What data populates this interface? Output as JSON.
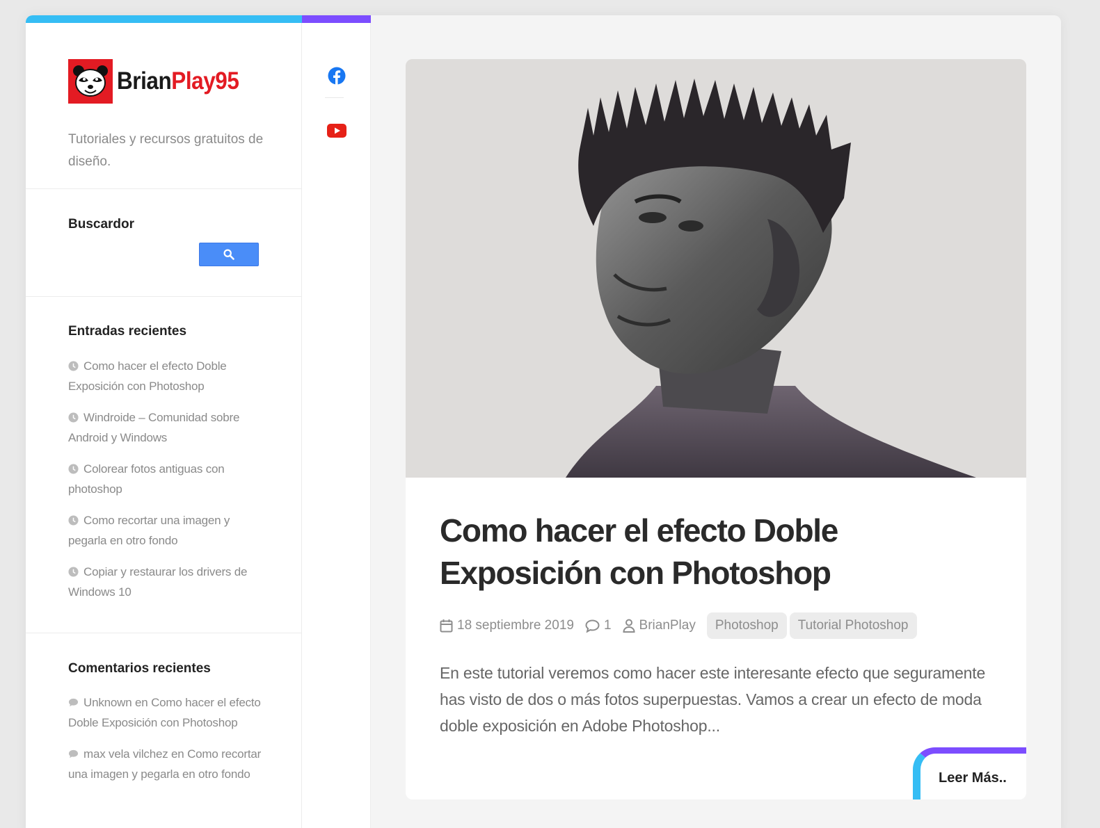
{
  "site": {
    "brand_first": "Brian",
    "brand_second": "Play95",
    "tagline": "Tutoriales y recursos gratuitos de diseño.",
    "brand_colors": {
      "red": "#e31b23",
      "blue": "#35bdf4",
      "purple": "#7c4dff"
    }
  },
  "social": [
    {
      "name": "facebook",
      "icon": "facebook-icon",
      "color": "#1877f2"
    },
    {
      "name": "youtube",
      "icon": "youtube-icon",
      "color": "#e62117"
    }
  ],
  "search": {
    "title": "Buscardor",
    "button_icon": "search-icon"
  },
  "recent_posts": {
    "title": "Entradas recientes",
    "items": [
      "Como hacer el efecto Doble Exposición con Photoshop",
      "Windroide – Comunidad sobre Android y Windows",
      "Colorear fotos antiguas con photoshop",
      "Como recortar una imagen y pegarla en otro fondo",
      "Copiar y restaurar los drivers de Windows 10"
    ]
  },
  "recent_comments": {
    "title": "Comentarios recientes",
    "connector": "en",
    "items": [
      {
        "author": "Unknown",
        "post": "Como hacer el efecto Doble Exposición con Photoshop"
      },
      {
        "author": "max vela vilchez",
        "post": "Como recortar una imagen y pegarla en otro fondo"
      }
    ]
  },
  "post": {
    "title": "Como hacer el efecto Doble Exposición con Photoshop",
    "date": "18 septiembre 2019",
    "comments": "1",
    "author": "BrianPlay",
    "tags": [
      "Photoshop",
      "Tutorial Photoshop"
    ],
    "excerpt": "En este tutorial veremos como hacer este interesante efecto que seguramente has visto de dos o más fotos superpuestas. Vamos a crear un efecto de moda doble exposición en Adobe Photoshop...",
    "read_more": "Leer Más.."
  }
}
